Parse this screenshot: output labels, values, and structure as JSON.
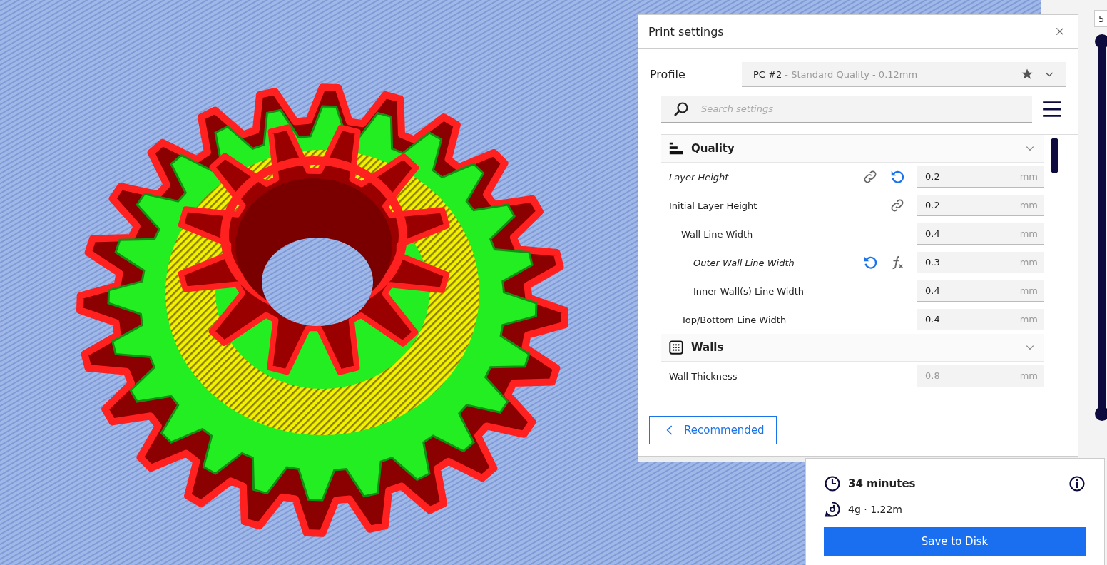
{
  "panel": {
    "title": "Print settings",
    "profile_label": "Profile",
    "profile": {
      "name": "PC #2",
      "detail": " - Standard Quality - 0.12mm"
    },
    "search": {
      "placeholder": "Search settings"
    },
    "categories": [
      {
        "kind": "quality",
        "title": "Quality",
        "expanded": true,
        "settings": [
          {
            "label": "Layer Height",
            "calculated": true,
            "linked": true,
            "resettable": true,
            "value": "0.2",
            "unit": "mm",
            "disabled": false
          },
          {
            "label": "Initial Layer Height",
            "calculated": false,
            "linked": true,
            "value": "0.2",
            "unit": "mm",
            "disabled": false,
            "children": [
              {
                "label": "Wall Line Width",
                "calculated": false,
                "value": "0.4",
                "unit": "mm",
                "disabled": false,
                "children": [
                  {
                    "label": "Outer Wall Line Width",
                    "calculated": true,
                    "resettable": true,
                    "formula": true,
                    "value": "0.3",
                    "unit": "mm",
                    "disabled": false
                  },
                  {
                    "label": "Inner Wall(s) Line Width",
                    "calculated": false,
                    "value": "0.4",
                    "unit": "mm",
                    "disabled": false
                  }
                ]
              },
              {
                "label": "Top/Bottom Line Width",
                "calculated": false,
                "value": "0.4",
                "unit": "mm",
                "disabled": false
              }
            ]
          }
        ]
      },
      {
        "kind": "walls",
        "title": "Walls",
        "expanded": true,
        "settings": [
          {
            "label": "Wall Thickness",
            "calculated": false,
            "value": "0.8",
            "unit": "mm",
            "disabled": true
          }
        ]
      }
    ],
    "back_button": "Recommended"
  },
  "summary": {
    "time": "34 minutes",
    "material": "4g · 1.22m",
    "save_button": "Save to Disk"
  },
  "layer_slider": {
    "top_label": "5"
  }
}
